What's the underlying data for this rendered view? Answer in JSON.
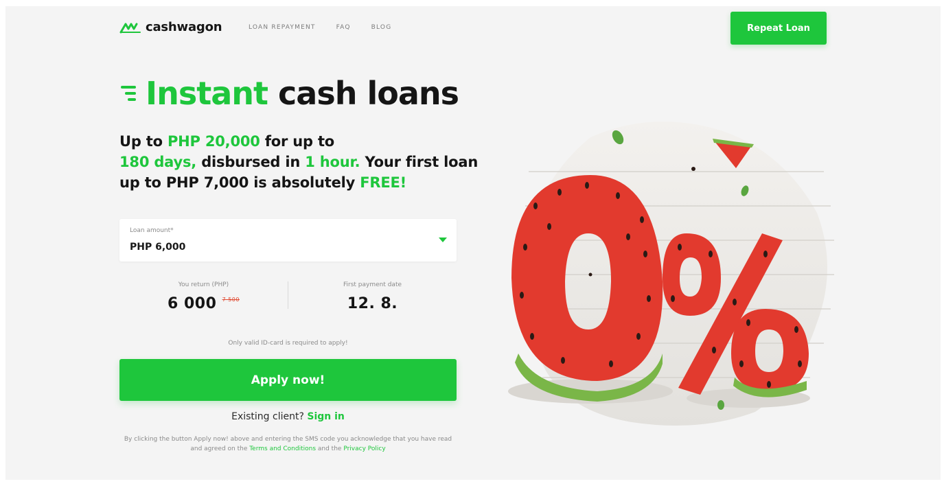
{
  "brand": {
    "name": "cashwagon"
  },
  "nav": {
    "items": [
      "LOAN REPAYMENT",
      "FAQ",
      "BLOG"
    ]
  },
  "header": {
    "repeat_loan_label": "Repeat Loan"
  },
  "hero": {
    "title_green": "Instant",
    "title_dark": "cash loans",
    "subtitle": {
      "p1": "Up to ",
      "amount": "PHP 20,000",
      "p2": " for up to",
      "days": "180 days,",
      "p3": " disbursed in ",
      "hour": "1 hour.",
      "p4": " Your first loan up to PHP 7,000 is absolutely ",
      "free": "FREE!"
    }
  },
  "form": {
    "loan_amount_label": "Loan amount*",
    "loan_amount_value": "PHP 6,000",
    "you_return_label": "You return (PHP)",
    "you_return_value": "6 000",
    "you_return_old": "7 500",
    "first_payment_label": "First payment date",
    "first_payment_value": "12. 8.",
    "note": "Only valid ID-card is required to apply!",
    "apply_label": "Apply now!",
    "existing_text": "Existing client?",
    "sign_in_label": "Sign in",
    "legal_1": "By clicking the button Apply now! above and entering the SMS code you acknowledge that you have read and agreed on the ",
    "terms_label": "Terms and Conditions",
    "legal_2": " and the ",
    "privacy_label": "Privacy Policy"
  },
  "hero_image": {
    "text": "0%"
  },
  "colors": {
    "accent": "#1ec63c",
    "dark": "#151515",
    "background": "#f4f4f4",
    "melon": "#e23a2e"
  }
}
